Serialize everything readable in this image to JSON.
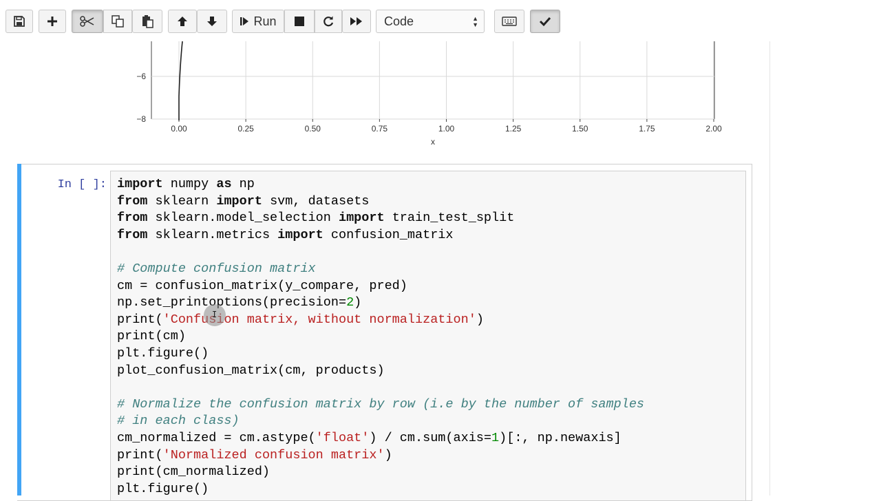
{
  "toolbar": {
    "buttons": [
      "save-icon",
      "plus-icon",
      "scissors-icon",
      "copy-icon",
      "paste-icon",
      "arrow-up-icon",
      "arrow-down-icon"
    ],
    "run_label": "Run",
    "cell_type": "Code"
  },
  "plot": {
    "x_ticks": [
      "0.00",
      "0.25",
      "0.50",
      "0.75",
      "1.00",
      "1.25",
      "1.50",
      "1.75",
      "2.00"
    ],
    "y_ticks": [
      "−6",
      "−8"
    ],
    "xlabel": "x"
  },
  "chart_data": {
    "type": "line",
    "xlabel": "x",
    "ylabel": "",
    "title": "",
    "x_ticks": [
      0.0,
      0.25,
      0.5,
      0.75,
      1.0,
      1.25,
      1.5,
      1.75,
      2.0
    ],
    "xlim": [
      -0.1,
      2.0
    ],
    "ylim": [
      -8,
      -5
    ]
  },
  "cell": {
    "prompt": "In [ ]:",
    "lines": [
      [
        [
          "kw",
          "import"
        ],
        [
          "t",
          " numpy "
        ],
        [
          "kw",
          "as"
        ],
        [
          "t",
          " np"
        ]
      ],
      [
        [
          "kw",
          "from"
        ],
        [
          "t",
          " sklearn "
        ],
        [
          "kw",
          "import"
        ],
        [
          "t",
          " svm, datasets"
        ]
      ],
      [
        [
          "kw",
          "from"
        ],
        [
          "t",
          " sklearn.model_selection "
        ],
        [
          "kw",
          "import"
        ],
        [
          "t",
          " train_test_split"
        ]
      ],
      [
        [
          "kw",
          "from"
        ],
        [
          "t",
          " sklearn.metrics "
        ],
        [
          "kw",
          "import"
        ],
        [
          "t",
          " confusion_matrix"
        ]
      ],
      [
        [
          "t",
          ""
        ]
      ],
      [
        [
          "cm",
          "# Compute confusion matrix"
        ]
      ],
      [
        [
          "t",
          "cm = confusion_matrix(y_compare, pred)"
        ]
      ],
      [
        [
          "t",
          "np.set_printoptions(precision="
        ],
        [
          "num",
          "2"
        ],
        [
          "t",
          ")"
        ]
      ],
      [
        [
          "t",
          "print("
        ],
        [
          "str",
          "'Confusion matrix, without normalization'"
        ],
        [
          "t",
          ")"
        ]
      ],
      [
        [
          "t",
          "print(cm)"
        ]
      ],
      [
        [
          "t",
          "plt.figure()"
        ]
      ],
      [
        [
          "t",
          "plot_confusion_matrix(cm, products)"
        ]
      ],
      [
        [
          "t",
          ""
        ]
      ],
      [
        [
          "cm",
          "# Normalize the confusion matrix by row (i.e by the number of samples"
        ]
      ],
      [
        [
          "cm",
          "# in each class)"
        ]
      ],
      [
        [
          "t",
          "cm_normalized = cm.astype("
        ],
        [
          "str",
          "'float'"
        ],
        [
          "t",
          ") / cm.sum(axis="
        ],
        [
          "num",
          "1"
        ],
        [
          "t",
          ")[:, np.newaxis]"
        ]
      ],
      [
        [
          "t",
          "print("
        ],
        [
          "str",
          "'Normalized confusion matrix'"
        ],
        [
          "t",
          ")"
        ]
      ],
      [
        [
          "t",
          "print(cm_normalized)"
        ]
      ],
      [
        [
          "t",
          "plt.figure()"
        ]
      ]
    ]
  }
}
